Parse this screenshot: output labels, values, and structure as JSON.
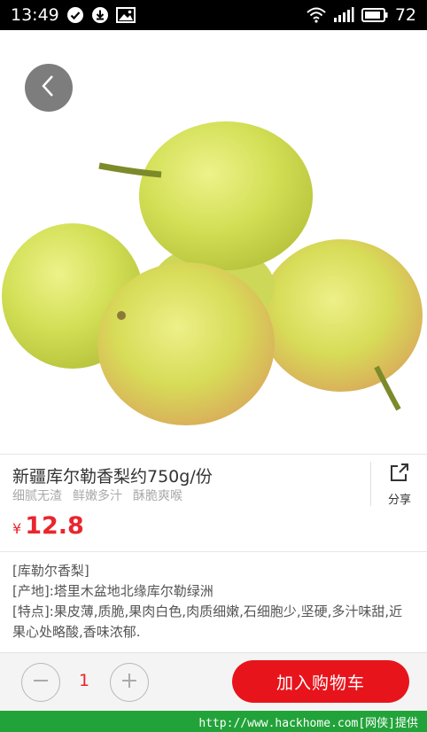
{
  "status_bar": {
    "time": "13:49",
    "battery": "72",
    "left_icons": [
      "check-circle-icon",
      "download-icon",
      "image-icon"
    ],
    "right_icons": [
      "wifi-icon",
      "signal-icon",
      "battery-icon"
    ]
  },
  "product": {
    "title": "新疆库尔勒香梨约750g/份",
    "tags": [
      "细腻无渣",
      "鲜嫩多汁",
      "酥脆爽喉"
    ],
    "share_label": "分享",
    "price_symbol": "¥",
    "price": "12.8"
  },
  "description": {
    "lines": [
      "[库勒尔香梨]",
      "[产地]:塔里木盆地北缘库尔勒绿洲",
      "[特点]:果皮薄,质脆,果肉白色,肉质细嫩,石细胞少,坚硬,多汁味甜,近果心处略酸,香味浓郁."
    ]
  },
  "cart": {
    "quantity": "1",
    "add_to_cart_label": "加入购物车"
  },
  "watermark": "http://www.hackhome.com[网侠]提供",
  "colors": {
    "accent": "#e8141c",
    "price": "#e8262d",
    "watermark_bg": "#22a33a"
  }
}
